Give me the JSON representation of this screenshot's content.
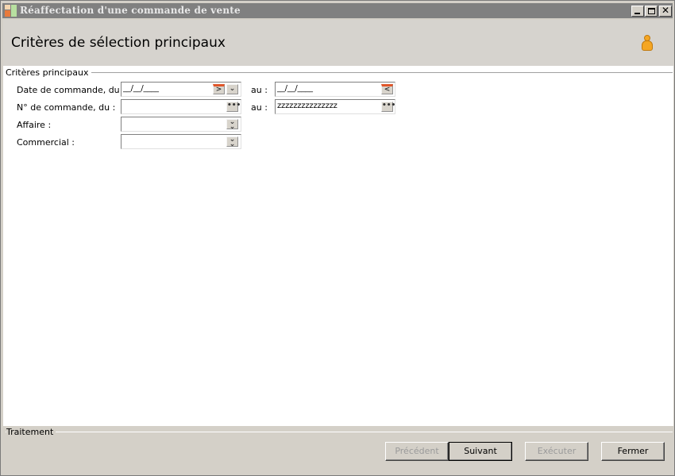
{
  "window": {
    "title": "Réaffectation d'une commande de vente"
  },
  "header": {
    "title": "Critères de sélection principaux",
    "user_icon": "user-icon"
  },
  "criteria": {
    "group_label": "Critères principaux",
    "rows": [
      {
        "label": "Date de commande, du :",
        "from_value": "__/__/____",
        "from_button": "calendar-next-icon",
        "from_extra_button": "chevron-down-icon",
        "to_label": "au :",
        "to_value": "__/__/____",
        "to_button": "calendar-prev-icon"
      },
      {
        "label": "N° de commande, du :",
        "from_value": "",
        "from_button": "ellipsis-icon",
        "to_label": "au :",
        "to_value": "zzzzzzzzzzzzzzz",
        "to_button": "ellipsis-icon"
      },
      {
        "label": "Affaire :",
        "from_value": "",
        "from_button": "double-chevron-down-icon"
      },
      {
        "label": "Commercial :",
        "from_value": "",
        "from_button": "double-chevron-down-icon"
      }
    ]
  },
  "footer": {
    "group_label": "Traitement",
    "buttons": {
      "previous": "Précédent",
      "next": "Suivant",
      "execute": "Exécuter",
      "close": "Fermer"
    }
  },
  "colors": {
    "titlebar": "#808080",
    "window_bg": "#d4d0c8",
    "accent_orange": "#e0562a",
    "user_icon": "#f5a623"
  }
}
